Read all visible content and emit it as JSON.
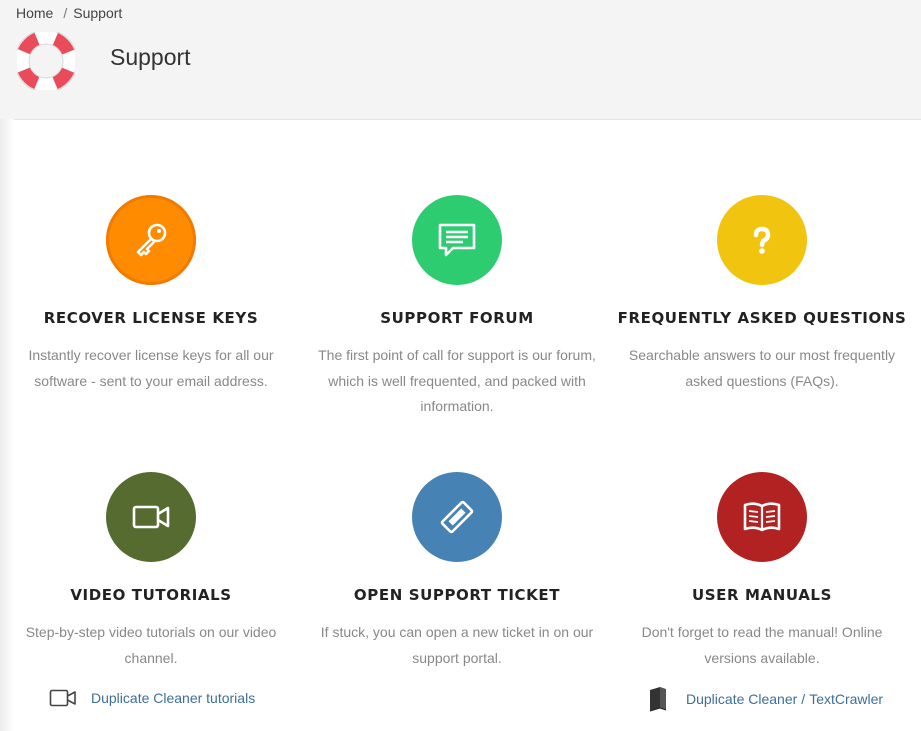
{
  "breadcrumb": {
    "home": "Home",
    "separator": "/",
    "current": "Support"
  },
  "page": {
    "title": "Support",
    "icon": "lifebuoy-icon"
  },
  "cards": [
    {
      "title": "RECOVER LICENSE KEYS",
      "description": "Instantly recover license keys for all our software - sent to your email address.",
      "icon": "key-icon",
      "color": "#ff8c00"
    },
    {
      "title": "SUPPORT FORUM",
      "description": "The first point of call for support is our forum, which is well frequented, and packed with information.",
      "icon": "chat-bubble-icon",
      "color": "#2ecc71"
    },
    {
      "title": "FREQUENTLY ASKED QUESTIONS",
      "description": "Searchable answers to our most frequently asked questions (FAQs).",
      "icon": "question-mark-icon",
      "color": "#f1c40f"
    },
    {
      "title": "VIDEO TUTORIALS",
      "description": "Step-by-step video tutorials on our video channel.",
      "icon": "video-camera-icon",
      "color": "#556b2f"
    },
    {
      "title": "OPEN SUPPORT TICKET",
      "description": "If stuck, you can open a new ticket in on our support portal.",
      "icon": "ticket-icon",
      "color": "#4682b4"
    },
    {
      "title": "USER MANUALS",
      "description": "Don't forget to read the manual! Online versions available.",
      "icon": "open-book-icon",
      "color": "#b22222"
    }
  ],
  "links": {
    "video": {
      "label": "Duplicate Cleaner tutorials",
      "icon": "video-camera-outline-icon"
    },
    "manuals": {
      "label1": "Duplicate Cleaner",
      "separator": "/",
      "label2": "TextCrawler",
      "icon": "book-icon"
    }
  }
}
